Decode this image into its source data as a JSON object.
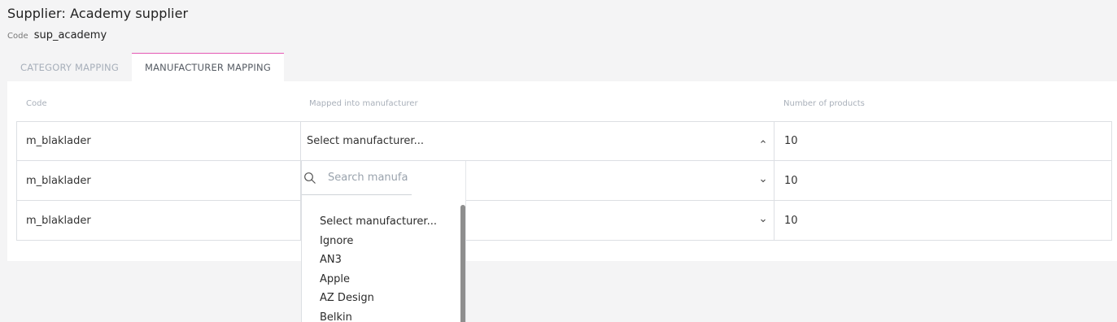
{
  "header": {
    "title": "Supplier: Academy supplier",
    "code_label": "Code",
    "code_value": "sup_academy"
  },
  "tabs": [
    {
      "label": "CATEGORY MAPPING",
      "active": false
    },
    {
      "label": "MANUFACTURER MAPPING",
      "active": true
    }
  ],
  "table": {
    "columns": [
      "Code",
      "Mapped into manufacturer",
      "Number of products"
    ],
    "rows": [
      {
        "code": "m_blaklader",
        "manufacturer": "Select manufacturer...",
        "count": "10",
        "open": true
      },
      {
        "code": "m_blaklader",
        "manufacturer": "",
        "count": "10",
        "open": false
      },
      {
        "code": "m_blaklader",
        "manufacturer": "",
        "count": "10",
        "open": false
      }
    ]
  },
  "dropdown": {
    "search_placeholder": "Search manufa",
    "options": [
      "Select manufacturer...",
      "Ignore",
      "AN3",
      "Apple",
      "AZ Design",
      "Belkin"
    ]
  },
  "colors": {
    "accent_tab_border": "#e458b4",
    "inactive_tab_text": "#a7afba",
    "border": "#dcdfe3"
  },
  "icons": [
    "search-icon",
    "chevron-up-icon",
    "chevron-down-icon"
  ]
}
